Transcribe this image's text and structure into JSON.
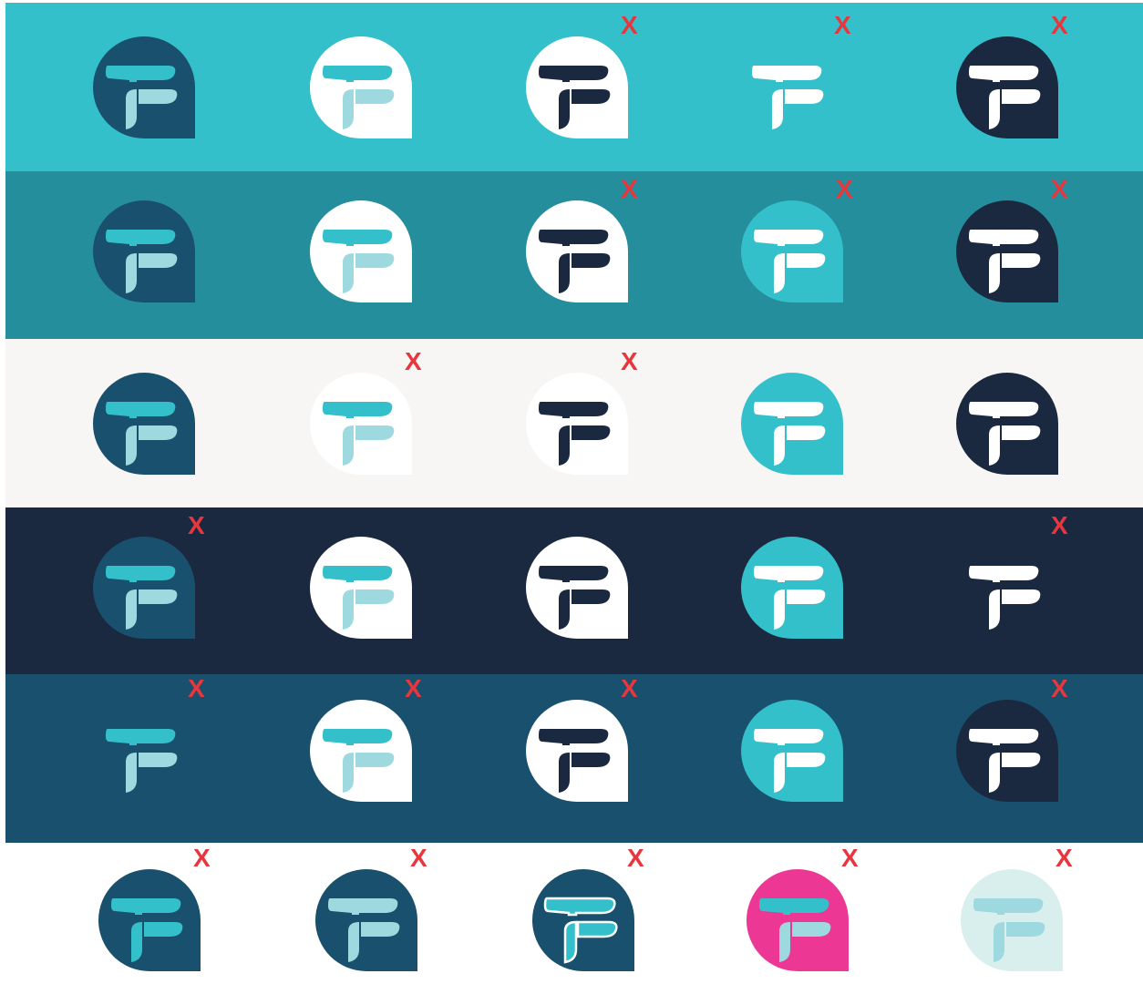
{
  "title": "",
  "colors": {
    "x_mark": "#E8363F",
    "white": "#FFFFFF",
    "cyan": "#34C0CB",
    "teal": "#258E9C",
    "offwhite": "#F7F6F4",
    "navy": "#1B2940",
    "deep_blue": "#19506D",
    "pale_cyan": "#9ED9DF",
    "magenta": "#EC3894",
    "mint": "#D8EFEE"
  },
  "x_mark_text": "X",
  "rows": [
    {
      "background": "#34C0CB",
      "items": [
        {
          "icon": "tf-badge-icon",
          "badge": "#19506D",
          "top": "#34C0CB",
          "stem": "#9ED9DF",
          "rejected": false
        },
        {
          "icon": "tf-badge-icon",
          "badge": "#FFFFFF",
          "top": "#34C0CB",
          "stem": "#9ED9DF",
          "rejected": false
        },
        {
          "icon": "tf-badge-icon",
          "badge": "#FFFFFF",
          "top": "#1B2940",
          "stem": "#1B2940",
          "rejected": true
        },
        {
          "icon": "tf-letters-icon",
          "badge": "none",
          "top": "#FFFFFF",
          "stem": "#FFFFFF",
          "rejected": true
        },
        {
          "icon": "tf-badge-icon",
          "badge": "#1B2940",
          "top": "#FFFFFF",
          "stem": "#FFFFFF",
          "rejected": true
        }
      ]
    },
    {
      "background": "#258E9C",
      "items": [
        {
          "icon": "tf-badge-icon",
          "badge": "#19506D",
          "top": "#34C0CB",
          "stem": "#9ED9DF",
          "rejected": false
        },
        {
          "icon": "tf-badge-icon",
          "badge": "#FFFFFF",
          "top": "#34C0CB",
          "stem": "#9ED9DF",
          "rejected": false
        },
        {
          "icon": "tf-badge-icon",
          "badge": "#FFFFFF",
          "top": "#1B2940",
          "stem": "#1B2940",
          "rejected": true
        },
        {
          "icon": "tf-badge-icon",
          "badge": "#34C0CB",
          "top": "#FFFFFF",
          "stem": "#FFFFFF",
          "rejected": true
        },
        {
          "icon": "tf-badge-icon",
          "badge": "#1B2940",
          "top": "#FFFFFF",
          "stem": "#FFFFFF",
          "rejected": true
        }
      ]
    },
    {
      "background": "#F7F6F4",
      "items": [
        {
          "icon": "tf-badge-icon",
          "badge": "#19506D",
          "top": "#34C0CB",
          "stem": "#9ED9DF",
          "rejected": false
        },
        {
          "icon": "tf-badge-icon",
          "badge": "#FFFFFF",
          "top": "#34C0CB",
          "stem": "#9ED9DF",
          "rejected": true
        },
        {
          "icon": "tf-badge-icon",
          "badge": "#FFFFFF",
          "top": "#1B2940",
          "stem": "#1B2940",
          "rejected": true
        },
        {
          "icon": "tf-badge-icon",
          "badge": "#34C0CB",
          "top": "#FFFFFF",
          "stem": "#FFFFFF",
          "rejected": false
        },
        {
          "icon": "tf-badge-icon",
          "badge": "#1B2940",
          "top": "#FFFFFF",
          "stem": "#FFFFFF",
          "rejected": false
        }
      ]
    },
    {
      "background": "#1B2940",
      "items": [
        {
          "icon": "tf-badge-icon",
          "badge": "#19506D",
          "top": "#34C0CB",
          "stem": "#9ED9DF",
          "rejected": true
        },
        {
          "icon": "tf-badge-icon",
          "badge": "#FFFFFF",
          "top": "#34C0CB",
          "stem": "#9ED9DF",
          "rejected": false
        },
        {
          "icon": "tf-badge-icon",
          "badge": "#FFFFFF",
          "top": "#1B2940",
          "stem": "#1B2940",
          "rejected": false
        },
        {
          "icon": "tf-badge-icon",
          "badge": "#34C0CB",
          "top": "#FFFFFF",
          "stem": "#FFFFFF",
          "rejected": false
        },
        {
          "icon": "tf-letters-icon",
          "badge": "none",
          "top": "#FFFFFF",
          "stem": "#FFFFFF",
          "rejected": true
        }
      ]
    },
    {
      "background": "#19506D",
      "items": [
        {
          "icon": "tf-letters-icon",
          "badge": "none",
          "top": "#34C0CB",
          "stem": "#9ED9DF",
          "rejected": true
        },
        {
          "icon": "tf-badge-icon",
          "badge": "#FFFFFF",
          "top": "#34C0CB",
          "stem": "#9ED9DF",
          "rejected": true
        },
        {
          "icon": "tf-badge-icon",
          "badge": "#FFFFFF",
          "top": "#1B2940",
          "stem": "#1B2940",
          "rejected": true
        },
        {
          "icon": "tf-badge-icon",
          "badge": "#34C0CB",
          "top": "#FFFFFF",
          "stem": "#FFFFFF",
          "rejected": false
        },
        {
          "icon": "tf-badge-icon",
          "badge": "#1B2940",
          "top": "#FFFFFF",
          "stem": "#FFFFFF",
          "rejected": true
        }
      ]
    },
    {
      "background": "#FFFFFF",
      "items": [
        {
          "icon": "tf-badge-icon",
          "badge": "#19506D",
          "top": "#34C0CB",
          "stem": "#34C0CB",
          "rejected": true
        },
        {
          "icon": "tf-badge-icon",
          "badge": "#19506D",
          "top": "#9ED9DF",
          "stem": "#9ED9DF",
          "rejected": true
        },
        {
          "icon": "tf-badge-outlined-icon",
          "badge": "#19506D",
          "top": "#34C0CB",
          "stem": "#34C0CB",
          "rejected": true
        },
        {
          "icon": "tf-badge-icon",
          "badge": "#EC3894",
          "top": "#34C0CB",
          "stem": "#9ED9DF",
          "rejected": true
        },
        {
          "icon": "tf-badge-icon",
          "badge": "#D8EFEE",
          "top": "#9ED9DF",
          "stem": "#9ED9DF",
          "rejected": true
        }
      ]
    }
  ]
}
